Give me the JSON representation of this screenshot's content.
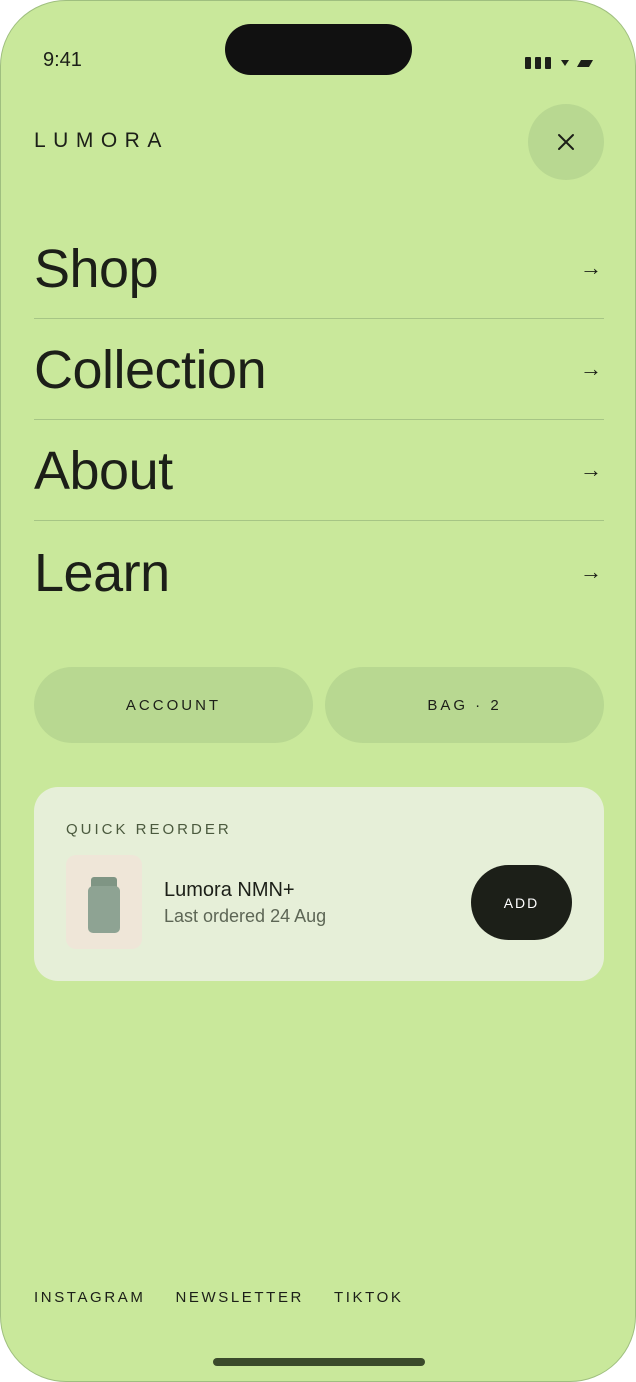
{
  "status_bar": {
    "time": "9:41"
  },
  "header": {
    "brand": "LUMORA",
    "close_icon": "close-icon"
  },
  "nav": {
    "items": [
      {
        "label": "Shop",
        "arrow": "→"
      },
      {
        "label": "Collection",
        "arrow": "→"
      },
      {
        "label": "About",
        "arrow": "→"
      },
      {
        "label": "Learn",
        "arrow": "→"
      }
    ]
  },
  "actions": {
    "account_label": "ACCOUNT",
    "bag_label": "BAG · 2"
  },
  "quick_reorder": {
    "heading": "QUICK REORDER",
    "product_name": "Lumora NMN+",
    "last_ordered": "Last ordered 24 Aug",
    "add_label": "ADD"
  },
  "footer": {
    "links": [
      "INSTAGRAM",
      "NEWSLETTER",
      "TIKTOK"
    ]
  },
  "colors": {
    "background": "#c9e89b",
    "pill": "#b8d891",
    "card": "#e6efd8",
    "primary_button": "#1c1f18"
  }
}
